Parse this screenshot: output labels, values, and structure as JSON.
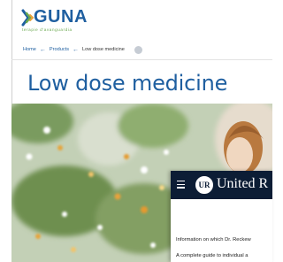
{
  "brand": {
    "name": "GUNA",
    "tagline": "terapie d'avanguardia",
    "primary_color": "#1f5fa0",
    "accent_color": "#6aa84f"
  },
  "breadcrumb": {
    "items": [
      "Home",
      "Products",
      "Low dose medicine"
    ],
    "separator_icon": "arrow-left-icon"
  },
  "page": {
    "title": "Low dose medicine"
  },
  "popup": {
    "brand": "United R",
    "logo_text": "UR",
    "header_color": "#0c1d35",
    "line1": "Information on which Dr. Reckew",
    "line2": "A complete guide to individual a"
  }
}
